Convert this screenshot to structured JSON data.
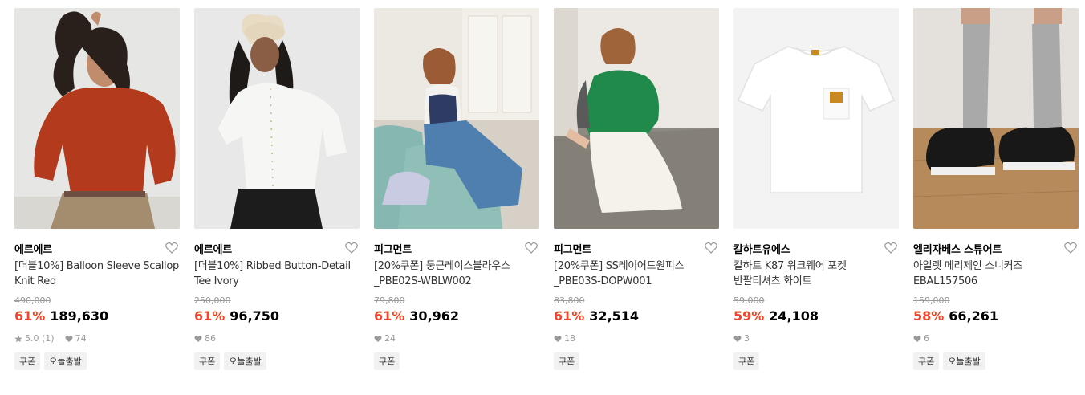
{
  "products": [
    {
      "brand": "에르에르",
      "name_line1": "[더블10%] Balloon Sleeve Scallop",
      "name_line2": "Knit Red",
      "original_price": "490,000",
      "discount": "61%",
      "price": "189,630",
      "rating": "5.0 (1)",
      "likes": "74",
      "tags": [
        "쿠폰",
        "오늘출발"
      ],
      "image_desc": "model in red balloon sleeve knit"
    },
    {
      "brand": "에르에르",
      "name_line1": "[더블10%] Ribbed Button-Detail",
      "name_line2": "Tee Ivory",
      "original_price": "250,000",
      "discount": "61%",
      "price": "96,750",
      "rating": "",
      "likes": "86",
      "tags": [
        "쿠폰",
        "오늘출발"
      ],
      "image_desc": "model in ivory ribbed button tee and cap"
    },
    {
      "brand": "피그먼트",
      "name_line1": "[20%쿠폰] 둥근레이스블라우스",
      "name_line2": "_PBE02S-WBLW002",
      "original_price": "79,800",
      "discount": "61%",
      "price": "30,962",
      "rating": "",
      "likes": "24",
      "tags": [
        "쿠폰"
      ],
      "image_desc": "model on mint sofa in lace blouse"
    },
    {
      "brand": "피그먼트",
      "name_line1": "[20%쿠폰] SS레이어드원피스",
      "name_line2": "_PBE03S-DOPW001",
      "original_price": "83,800",
      "discount": "61%",
      "price": "32,514",
      "rating": "",
      "likes": "18",
      "tags": [
        "쿠폰"
      ],
      "image_desc": "model in green cardigan layered dress"
    },
    {
      "brand": "칼하트유에스",
      "name_line1": "칼하트 K87 워크웨어 포켓",
      "name_line2": "반팔티셔츠 화이트",
      "original_price": "59,000",
      "discount": "59%",
      "price": "24,108",
      "rating": "",
      "likes": "3",
      "tags": [
        "쿠폰"
      ],
      "image_desc": "white pocket t-shirt"
    },
    {
      "brand": "엘리자베스 스튜어트",
      "name_line1": "아일렛 메리제인 스니커즈",
      "name_line2": "EBAL157506",
      "original_price": "159,000",
      "discount": "58%",
      "price": "66,261",
      "rating": "",
      "likes": "6",
      "tags": [
        "쿠폰",
        "오늘출발"
      ],
      "image_desc": "black mary jane sneakers"
    }
  ],
  "colors": {
    "discount": "#f0462d",
    "meta": "#9a9a9a",
    "tag_bg": "#f1f1f1"
  },
  "icons": {
    "like": "heart-outline-icon",
    "rating": "star-icon",
    "likes": "heart-icon"
  }
}
